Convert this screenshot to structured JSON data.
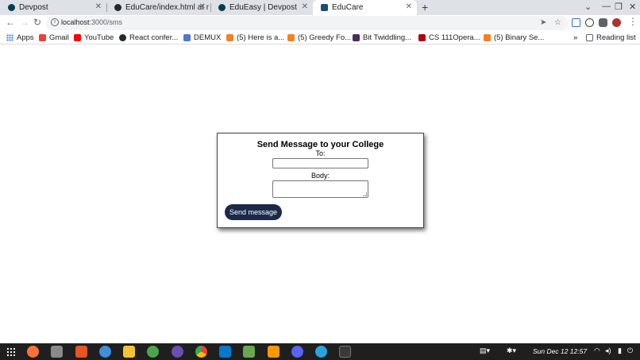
{
  "browser": {
    "tabs": [
      {
        "title": "Devpost",
        "favicon_color": "#003e54"
      },
      {
        "title": "EduCare/index.html at m",
        "favicon_color": "#24292e"
      },
      {
        "title": "EduEasy | Devpost",
        "favicon_color": "#003e54"
      },
      {
        "title": "EduCare",
        "favicon_color": "#1b4f72"
      }
    ],
    "active_tab_index": 3,
    "address": {
      "host": "localhost",
      "path": ":3000/sms"
    },
    "bookmarks": [
      {
        "label": "Apps",
        "icon_color": "#4285f4"
      },
      {
        "label": "Gmail",
        "icon_color": "#ea4335"
      },
      {
        "label": "YouTube",
        "icon_color": "#ff0000"
      },
      {
        "label": "React confer...",
        "icon_color": "#24292e"
      },
      {
        "label": "DEMUX",
        "icon_color": "#4f78c9"
      },
      {
        "label": "(5) Here is a...",
        "icon_color": "#f48024"
      },
      {
        "label": "(5) Greedy Fo...",
        "icon_color": "#f48024"
      },
      {
        "label": "Bit Twiddling...",
        "icon_color": "#4a2c5a"
      },
      {
        "label": "CS 111Opera...",
        "icon_color": "#b1040e"
      },
      {
        "label": "(5) Binary Se...",
        "icon_color": "#f48024"
      },
      {
        "label": "»",
        "icon_color": ""
      },
      {
        "label": "Reading list",
        "icon_color": "#5f6368"
      }
    ]
  },
  "page": {
    "title": "Send Message to your College",
    "to_label": "To:",
    "to_value": "",
    "body_label": "Body:",
    "body_value": "",
    "send_label": "Send message"
  },
  "taskbar": {
    "clock": "Sun Dec 12  12:57",
    "apps": [
      {
        "name": "firefox",
        "color": "#ff7139"
      },
      {
        "name": "files",
        "color": "#8a8a8a"
      },
      {
        "name": "software-center",
        "color": "#e95420"
      },
      {
        "name": "help",
        "color": "#3d8fd8"
      },
      {
        "name": "jupyter-lab",
        "color": "#f4c430"
      },
      {
        "name": "spotify-like",
        "color": "#4ca64c"
      },
      {
        "name": "obs",
        "color": "#6a4fb3"
      },
      {
        "name": "chrome",
        "color": "#34a853"
      },
      {
        "name": "vscode",
        "color": "#007acc"
      },
      {
        "name": "vim",
        "color": "#6aa84f"
      },
      {
        "name": "sublime",
        "color": "#ff9800"
      },
      {
        "name": "discord",
        "color": "#5865f2"
      },
      {
        "name": "telegram",
        "color": "#2aa3df"
      },
      {
        "name": "terminal",
        "color": "#3a3a3a"
      }
    ]
  }
}
